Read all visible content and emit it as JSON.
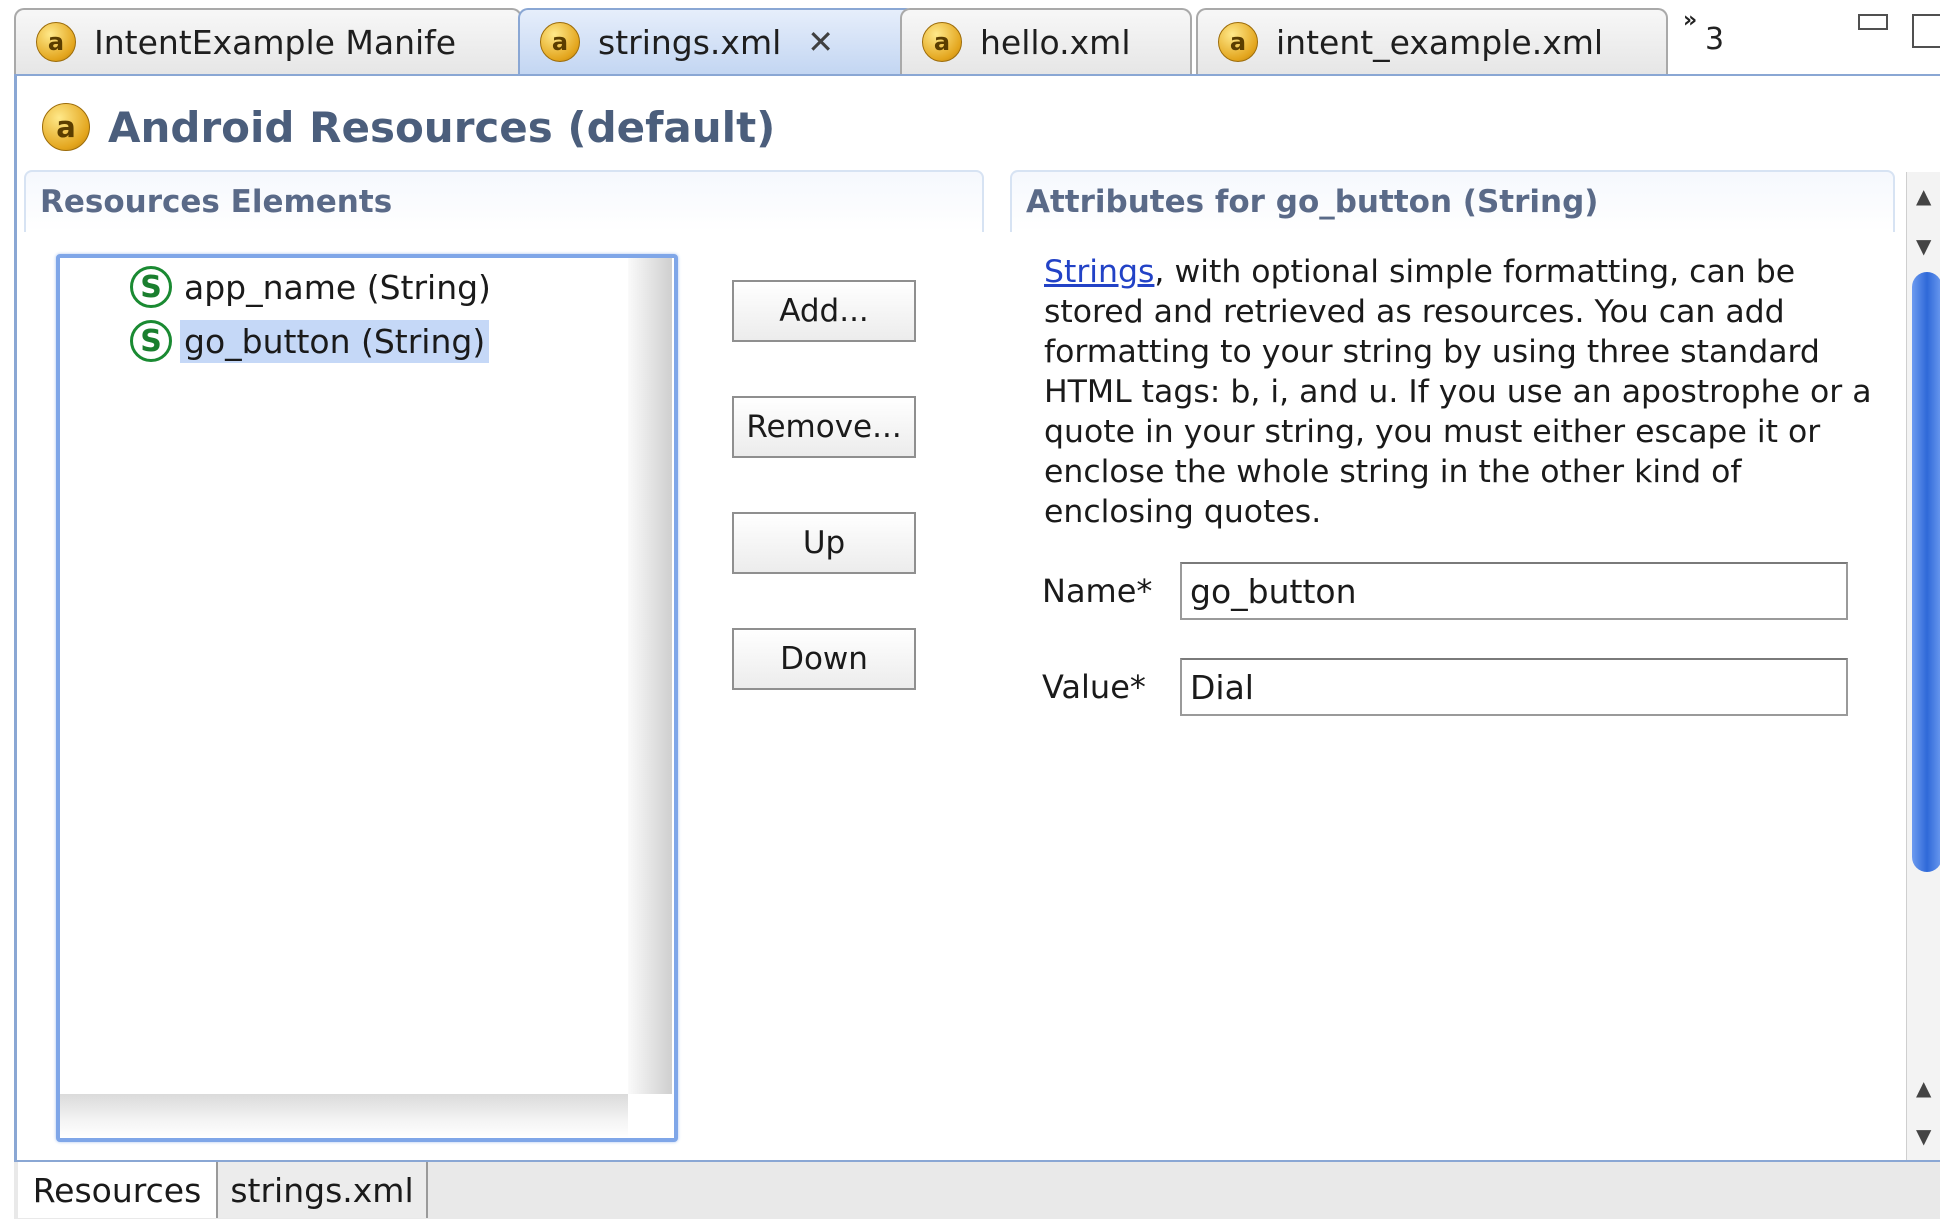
{
  "tabs": [
    {
      "label": "IntentExample Manife",
      "icon": "android-resource-icon",
      "active": false
    },
    {
      "label": "strings.xml",
      "icon": "android-resource-icon",
      "active": true,
      "close_icon": "close-icon"
    },
    {
      "label": "hello.xml",
      "icon": "android-resource-icon",
      "active": false
    },
    {
      "label": "intent_example.xml",
      "icon": "android-resource-icon",
      "active": false
    }
  ],
  "tab_overflow": {
    "chevron": "»",
    "count": "3"
  },
  "icon_glyph": "a",
  "page": {
    "title": "Android Resources (default)"
  },
  "left_section": {
    "title": "Resources Elements",
    "items": [
      {
        "label": "app_name (String)",
        "icon_letter": "S",
        "selected": false
      },
      {
        "label": "go_button (String)",
        "icon_letter": "S",
        "selected": true
      }
    ],
    "buttons": {
      "add": "Add...",
      "remove": "Remove...",
      "up": "Up",
      "down": "Down"
    }
  },
  "right_section": {
    "title": "Attributes for go_button (String)",
    "description_link": "Strings",
    "description_text": ", with optional simple formatting, can be stored and retrieved as resources. You can add formatting to your string by using three standard HTML tags: b, i, and u. If you use an apostrophe or a quote in your string, you must either escape it or enclose the whole string in the other kind of enclosing quotes.",
    "name_label": "Name*",
    "name_value": "go_button",
    "value_label": "Value*",
    "value_value": "Dial"
  },
  "bottom_tabs": [
    "Resources",
    "strings.xml"
  ],
  "colors": {
    "accent": "#7fa6e8",
    "selection": "#c5d8f7",
    "header_text": "#4b5e7c",
    "link": "#2242c6"
  }
}
